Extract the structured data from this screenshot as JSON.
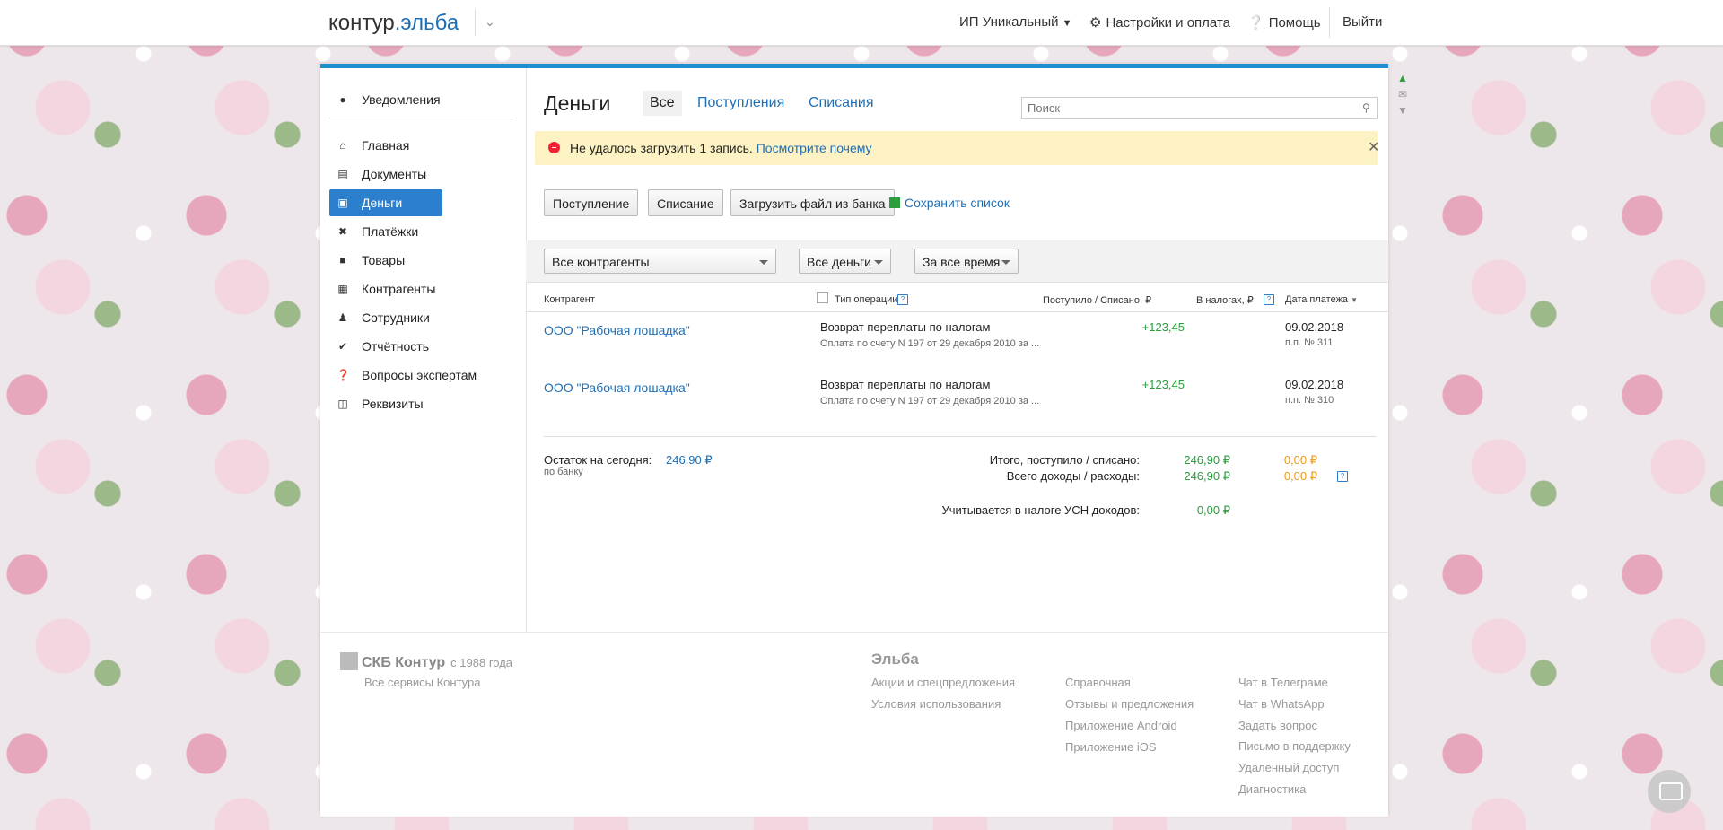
{
  "topbar": {
    "logo_prefix": "контур",
    "logo_dot": ".",
    "logo_suffix": "эльба",
    "org": "ИП Уникальный",
    "settings": "Настройки и оплата",
    "help": "Помощь",
    "logout": "Выйти"
  },
  "sidebar": {
    "items": [
      {
        "label": "Уведомления",
        "icon": "bell-icon"
      },
      {
        "label": "Главная",
        "icon": "home-icon"
      },
      {
        "label": "Документы",
        "icon": "documents-icon"
      },
      {
        "label": "Деньги",
        "icon": "money-icon"
      },
      {
        "label": "Платёжки",
        "icon": "payment-icon"
      },
      {
        "label": "Товары",
        "icon": "goods-icon"
      },
      {
        "label": "Контрагенты",
        "icon": "contractors-icon"
      },
      {
        "label": "Сотрудники",
        "icon": "employee-icon"
      },
      {
        "label": "Отчётность",
        "icon": "report-icon"
      },
      {
        "label": "Вопросы экспертам",
        "icon": "question-icon"
      },
      {
        "label": "Реквизиты",
        "icon": "requisites-icon"
      }
    ]
  },
  "main": {
    "title": "Деньги",
    "tabs": [
      "Все",
      "Поступления",
      "Списания"
    ],
    "search_placeholder": "Поиск",
    "alert": {
      "text": "Не удалось загрузить 1 запись.",
      "link": "Посмотрите почему"
    },
    "buttons": {
      "income": "Поступление",
      "expense": "Списание",
      "upload": "Загрузить файл из банка",
      "save": "Сохранить список"
    },
    "filters": {
      "contractors": "Все контрагенты",
      "money": "Все деньги",
      "period": "За все время"
    },
    "columns": {
      "contractor": "Контрагент",
      "op_type": "Тип операции",
      "in_out": "Поступило / Списано, ₽",
      "taxes": "В налогах, ₽",
      "date": "Дата платежа"
    },
    "rows": [
      {
        "contractor": "ООО \"Рабочая лошадка\"",
        "operation": "Возврат переплаты по налогам",
        "description": "Оплата по счету N 197 от 29 декабря 2010 за ...",
        "amount": "+123,45",
        "date": "09.02.2018",
        "pp": "п.п. № 311"
      },
      {
        "contractor": "ООО \"Рабочая лошадка\"",
        "operation": "Возврат переплаты по налогам",
        "description": "Оплата по счету N 197 от 29 декабря 2010 за ...",
        "amount": "+123,45",
        "date": "09.02.2018",
        "pp": "п.п. № 310"
      }
    ],
    "summary": {
      "balance_label": "Остаток на сегодня:",
      "balance_value": "246,90 ₽",
      "balance_sub": "по банку",
      "total_label": "Итого, поступило / списано:",
      "total_in": "246,90 ₽",
      "total_out": "0,00 ₽",
      "income_label": "Всего доходы / расходы:",
      "income_in": "246,90 ₽",
      "income_out": "0,00 ₽",
      "usn_label": "Учитывается в налоге УСН доходов:",
      "usn_value": "0,00 ₽"
    }
  },
  "footer": {
    "brand": "СКБ Контур",
    "since": "с 1988 года",
    "all_services": "Все сервисы Контура",
    "elba_head": "Эльба",
    "col1": [
      "Акции и спецпредложения",
      "Условия использования"
    ],
    "col2": [
      "Справочная",
      "Отзывы и предложения",
      "Приложение Android",
      "Приложение iOS"
    ],
    "col3": [
      "Чат в Телеграме",
      "Чат в WhatsApp",
      "Задать вопрос",
      "Письмо в поддержку",
      "Удалённый доступ",
      "Диагностика"
    ]
  },
  "colors": {
    "accent": "#2b7fcc",
    "income": "#2a9d3c",
    "expense": "#e89b1a",
    "alert_bg": "#fdf2c4"
  }
}
